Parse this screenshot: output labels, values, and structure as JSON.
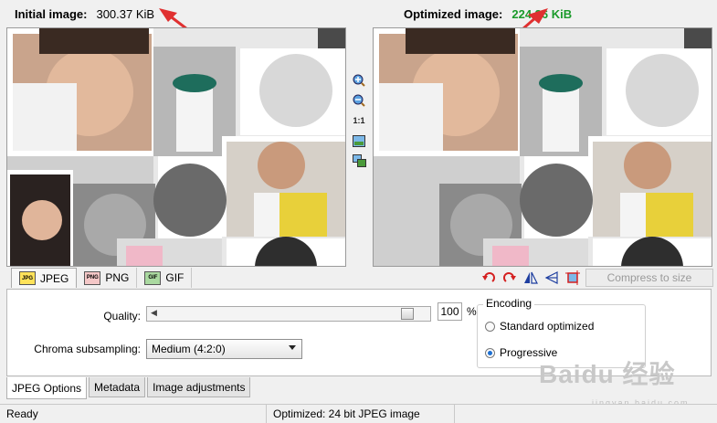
{
  "header": {
    "initial_label": "Initial image:",
    "initial_size": "300.37 KiB",
    "optimized_label": "Optimized image:",
    "optimized_size": "224.26 KiB"
  },
  "colors": {
    "accent_green": "#1a9a2a",
    "arrow_red": "#e03030",
    "radio_selected": "#1d6fd1"
  },
  "preview": {
    "left_image_icon": "photo-collage-icon",
    "right_image_icon": "photo-collage-icon"
  },
  "view_tools": {
    "zoom_in": "zoom-in-icon",
    "zoom_out": "zoom-out-icon",
    "actual_size": "1:1",
    "fit": "fit-image-icon",
    "compare": "compare-icon"
  },
  "format_tabs": [
    {
      "label": "JPEG",
      "icon": "JPG"
    },
    {
      "label": "PNG",
      "icon": "PNG"
    },
    {
      "label": "GIF",
      "icon": "GIF"
    }
  ],
  "transform_tools": [
    "rotate-left-icon",
    "rotate-right-icon",
    "flip-horizontal-icon",
    "flip-vertical-icon",
    "crop-icon"
  ],
  "compress_button": "Compress to size",
  "options": {
    "quality_label": "Quality:",
    "quality_value": "100",
    "quality_fraction": 1.0,
    "percent_sign": "%",
    "chroma_label": "Chroma subsampling:",
    "chroma_value": "Medium (4:2:0)",
    "encoding_title": "Encoding",
    "encoding_options": [
      "Standard optimized",
      "Progressive"
    ],
    "encoding_selected": "Progressive"
  },
  "bottom_tabs": [
    "JPEG Options",
    "Metadata",
    "Image adjustments"
  ],
  "status": {
    "left": "Ready",
    "middle": "Optimized: 24 bit JPEG image"
  },
  "watermark": {
    "main": "Baidu 经验",
    "sub": "jingyan.baidu.com"
  }
}
